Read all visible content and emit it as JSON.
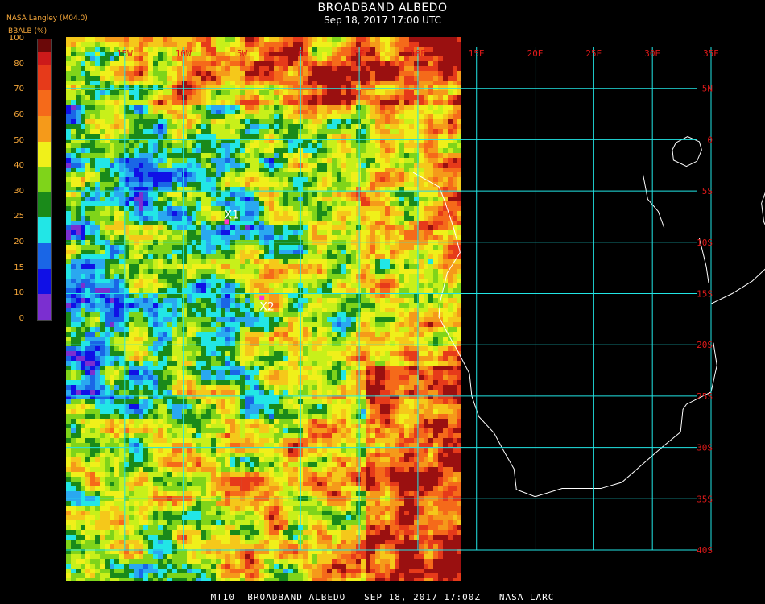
{
  "header": {
    "title": "BROADBAND ALBEDO",
    "subtitle": "Sep 18, 2017 17:00 UTC",
    "source": "NASA Langley (M04.0)"
  },
  "colorbar": {
    "unit_label": "BBALB (%)",
    "ticks": [
      "100",
      "80",
      "70",
      "60",
      "50",
      "40",
      "30",
      "25",
      "20",
      "15",
      "10",
      "0"
    ],
    "tick_values": [
      100,
      80,
      70,
      60,
      50,
      40,
      30,
      25,
      20,
      15,
      10,
      0
    ],
    "bins": [
      {
        "lo": 0,
        "hi": 5,
        "color": "#7b2fd0"
      },
      {
        "lo": 5,
        "hi": 10,
        "color": "#1010e6"
      },
      {
        "lo": 10,
        "hi": 15,
        "color": "#1a66e6"
      },
      {
        "lo": 15,
        "hi": 20,
        "color": "#2aa8f0"
      },
      {
        "lo": 20,
        "hi": 25,
        "color": "#22e6e6"
      },
      {
        "lo": 25,
        "hi": 30,
        "color": "#1a8a1a"
      },
      {
        "lo": 30,
        "hi": 35,
        "color": "#7fd41a"
      },
      {
        "lo": 35,
        "hi": 40,
        "color": "#c8f01a"
      },
      {
        "lo": 40,
        "hi": 45,
        "color": "#f0f01a"
      },
      {
        "lo": 45,
        "hi": 50,
        "color": "#f5c81a"
      },
      {
        "lo": 50,
        "hi": 55,
        "color": "#f59a1a"
      },
      {
        "lo": 55,
        "hi": 60,
        "color": "#f56a1a"
      },
      {
        "lo": 60,
        "hi": 65,
        "color": "#e63a1a"
      },
      {
        "lo": 65,
        "hi": 70,
        "color": "#cc1a1a"
      },
      {
        "lo": 70,
        "hi": 75,
        "color": "#9a1010"
      },
      {
        "lo": 75,
        "hi": 80,
        "color": "#6a0808"
      }
    ]
  },
  "map": {
    "lon_labels": [
      "15W",
      "10W",
      "5W",
      "0",
      "5E",
      "10E",
      "15E",
      "20E",
      "25E",
      "30E",
      "35E"
    ],
    "lon_values": [
      -15,
      -10,
      -5,
      0,
      5,
      10,
      15,
      20,
      25,
      30,
      35
    ],
    "lat_labels": [
      "5N",
      "0",
      "5S",
      "10S",
      "15S",
      "20S",
      "25S",
      "30S",
      "35S",
      "40S"
    ],
    "lat_values": [
      5,
      0,
      -5,
      -10,
      -15,
      -20,
      -25,
      -30,
      -35,
      -40
    ],
    "lon_range": [
      -20,
      35
    ],
    "lat_range": [
      -40,
      10
    ],
    "grid_color": "#22e6e6",
    "label_color": "#e01a1a",
    "coast_color": "#ffffff",
    "markers": [
      {
        "label": "X1",
        "lon": -6.3,
        "lat": -8.0,
        "color": "#ff33cc"
      },
      {
        "label": "X2",
        "lon": -3.3,
        "lat": -15.4,
        "color": "#ff33cc"
      }
    ]
  },
  "footer": "MT10  BROADBAND ALBEDO   SEP 18, 2017 17:00Z   NASA LARC"
}
